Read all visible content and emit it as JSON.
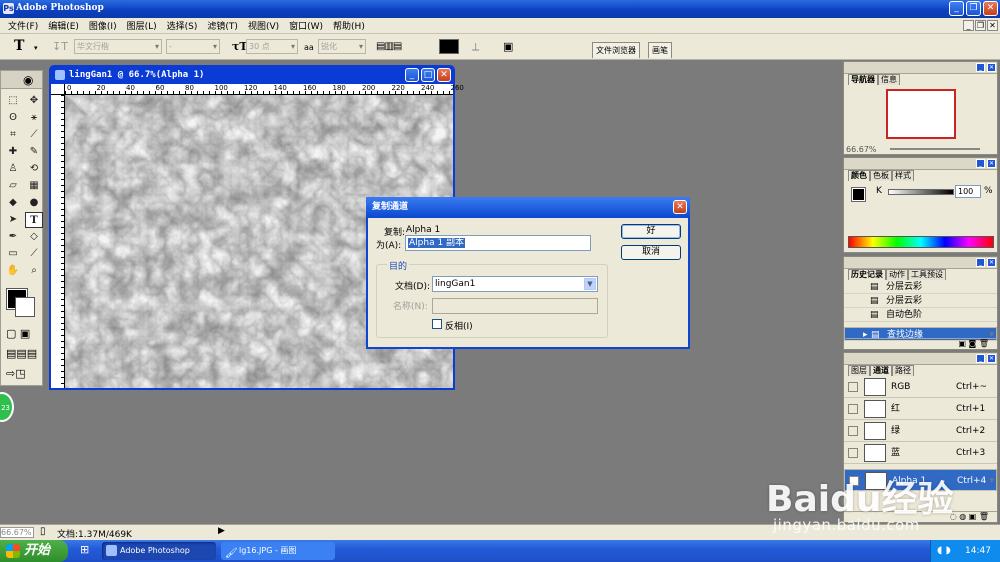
{
  "app": {
    "title": "Adobe Photoshop"
  },
  "menu": [
    "文件(F)",
    "编辑(E)",
    "图像(I)",
    "图层(L)",
    "选择(S)",
    "滤镜(T)",
    "视图(V)",
    "窗口(W)",
    "帮助(H)"
  ],
  "options": {
    "tool_glyph": "T",
    "font_family": "华文行楷",
    "font_style": "-",
    "font_size": "30 点",
    "aa_label": "aa",
    "antialias": "锐化",
    "tabs": [
      "文件浏览器",
      "画笔"
    ]
  },
  "document": {
    "title": "lingGan1 @ 66.7%(Alpha 1)",
    "ruler_ticks": [
      "0",
      "20",
      "40",
      "60",
      "80",
      "100",
      "120",
      "140",
      "160",
      "180",
      "200",
      "220",
      "240",
      "260"
    ]
  },
  "dialog": {
    "title": "复制通道",
    "duplicate_label": "复制:",
    "duplicate_value": "Alpha 1",
    "as_label": "为(A):",
    "as_value": "Alpha 1 副本",
    "ok": "好",
    "cancel": "取消",
    "dest_label": "目的",
    "doc_label": "文档(D):",
    "doc_value": "lingGan1",
    "name_label": "名称(N):",
    "name_value": "",
    "invert_label": "反相(I)",
    "invert_checked": false
  },
  "navigator": {
    "tabs": [
      "导航器",
      "信息"
    ],
    "zoom": "66.67%"
  },
  "color": {
    "tabs": [
      "颜色",
      "色板",
      "样式"
    ],
    "channel": "K",
    "value": "100",
    "unit": "%"
  },
  "history": {
    "tabs": [
      "历史记录",
      "动作",
      "工具预设"
    ],
    "items": [
      {
        "label": "分层云彩",
        "selected": false
      },
      {
        "label": "分层云彩",
        "selected": false
      },
      {
        "label": "自动色阶",
        "selected": false
      },
      {
        "label": "查找边缘",
        "selected": true
      }
    ]
  },
  "channels": {
    "tabs": [
      "图层",
      "通道",
      "路径"
    ],
    "items": [
      {
        "name": "RGB",
        "shortcut": "Ctrl+~",
        "selected": false
      },
      {
        "name": "红",
        "shortcut": "Ctrl+1",
        "selected": false
      },
      {
        "name": "绿",
        "shortcut": "Ctrl+2",
        "selected": false
      },
      {
        "name": "蓝",
        "shortcut": "Ctrl+3",
        "selected": false
      },
      {
        "name": "Alpha 1",
        "shortcut": "Ctrl+4",
        "selected": true
      }
    ]
  },
  "status": {
    "zoom": "66.67%",
    "doc_info": "文档:1.37M/469K"
  },
  "taskbar": {
    "start": "开始",
    "tasks": [
      "Adobe Photoshop",
      "lg16.JPG - 画图"
    ],
    "clock": "14:47"
  },
  "watermark": {
    "brand": "Baidu经验",
    "url": "jingyan.baidu.com"
  },
  "colors": {
    "titlebar": "#0b3aa8",
    "selection": "#316ac5",
    "chrome": "#ece9d8",
    "workspace": "#7b7b7b"
  }
}
